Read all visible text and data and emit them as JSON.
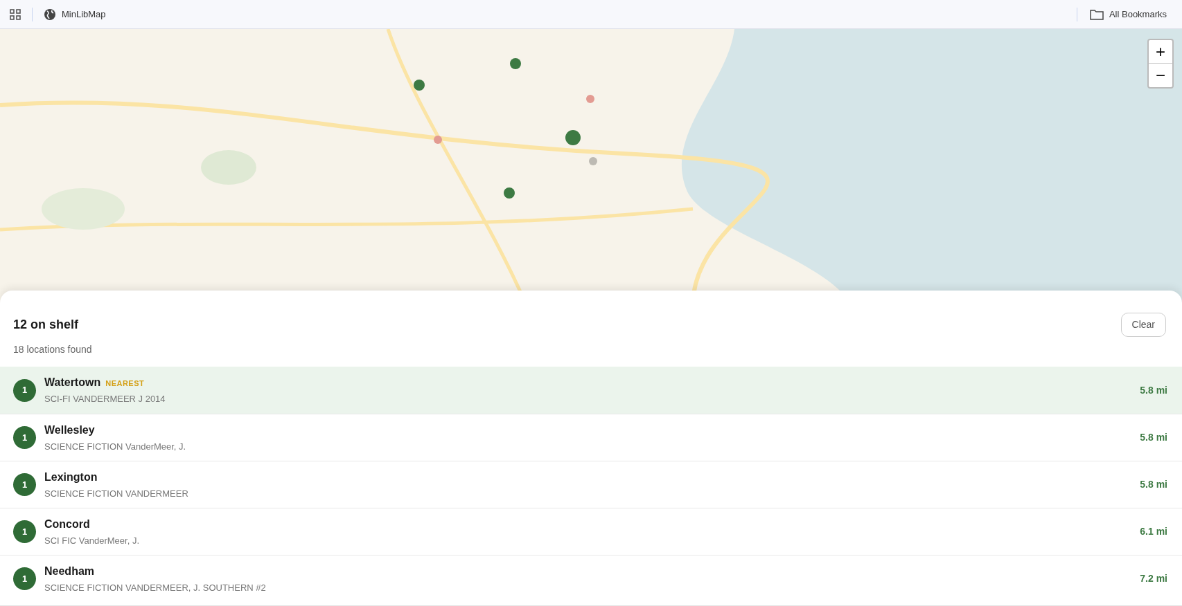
{
  "bookmarks_bar": {
    "app": "MinLibMap",
    "folder": "All Bookmarks"
  },
  "map": {
    "zoom_in": "+",
    "zoom_out": "−"
  },
  "panel": {
    "title": "12 on shelf",
    "subtitle": "18 locations found",
    "clear": "Clear",
    "results": [
      {
        "count": "1",
        "name": "Watertown",
        "badge": "NEAREST",
        "call_number": "SCI-FI VANDERMEER J 2014",
        "distance": "5.8 mi",
        "selected": true
      },
      {
        "count": "1",
        "name": "Wellesley",
        "call_number": "SCIENCE FICTION VanderMeer, J.",
        "distance": "5.8 mi",
        "selected": false
      },
      {
        "count": "1",
        "name": "Lexington",
        "call_number": "SCIENCE FICTION VANDERMEER",
        "distance": "5.8 mi",
        "selected": false
      },
      {
        "count": "1",
        "name": "Concord",
        "call_number": "SCI FIC VanderMeer, J.",
        "distance": "6.1 mi",
        "selected": false
      },
      {
        "count": "1",
        "name": "Needham",
        "call_number": "SCIENCE FICTION VANDERMEER, J. SOUTHERN #2",
        "distance": "7.2 mi",
        "selected": false
      }
    ]
  }
}
